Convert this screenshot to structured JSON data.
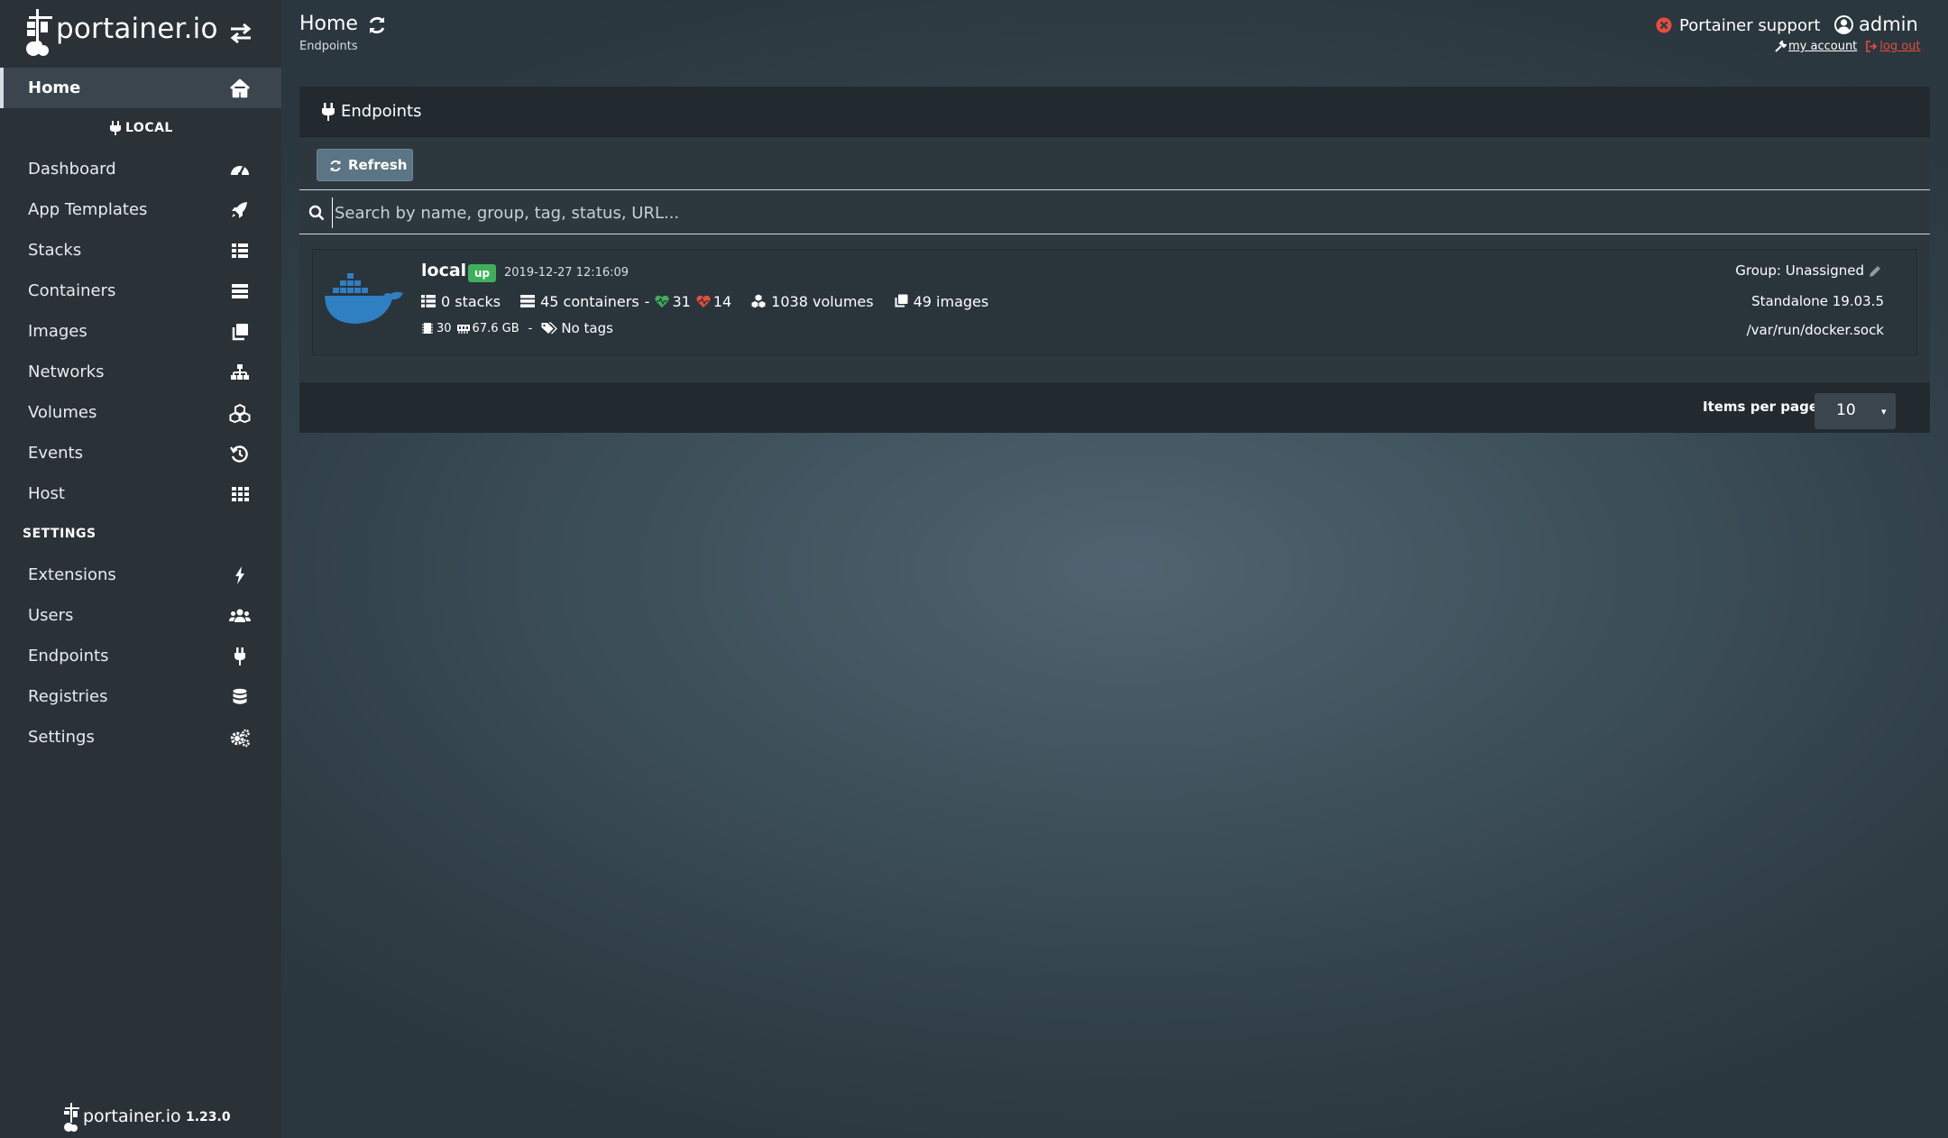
{
  "brand": {
    "name": "portainer.io",
    "logo_icon": "portainer-logo-icon",
    "toggle_icon": "sidebar-toggle-arrows-icon"
  },
  "sidebar": {
    "items": [
      {
        "label": "Home",
        "icon": "home-icon",
        "active": true
      },
      {
        "label": "Dashboard",
        "icon": "tachometer-icon"
      },
      {
        "label": "App Templates",
        "icon": "rocket-icon"
      },
      {
        "label": "Stacks",
        "icon": "th-list-icon"
      },
      {
        "label": "Containers",
        "icon": "server-icon"
      },
      {
        "label": "Images",
        "icon": "clone-icon"
      },
      {
        "label": "Networks",
        "icon": "sitemap-icon"
      },
      {
        "label": "Volumes",
        "icon": "cubes-icon"
      },
      {
        "label": "Events",
        "icon": "history-icon"
      },
      {
        "label": "Host",
        "icon": "th-icon"
      },
      {
        "label": "Extensions",
        "icon": "bolt-icon"
      },
      {
        "label": "Users",
        "icon": "users-icon"
      },
      {
        "label": "Endpoints",
        "icon": "plug-icon"
      },
      {
        "label": "Registries",
        "icon": "database-icon"
      },
      {
        "label": "Settings",
        "icon": "cogs-icon"
      }
    ],
    "endpoint_section": "LOCAL",
    "settings_section": "SETTINGS",
    "footer": {
      "name": "portainer.io",
      "version": "1.23.0"
    }
  },
  "header": {
    "title": "Home",
    "breadcrumb": "Endpoints",
    "support_label": "Portainer support",
    "user_label": "admin",
    "my_account_label": "my account",
    "log_out_label": "log out"
  },
  "endpoints_widget": {
    "title": "Endpoints",
    "refresh_label": "Refresh",
    "search_placeholder": "Search by name, group, tag, status, URL...",
    "endpoint": {
      "name": "local",
      "status": "up",
      "date": "2019-12-27 12:16:09",
      "stacks": "0 stacks",
      "containers": "45 containers",
      "containers_sep": "-",
      "healthy": "31",
      "unhealthy": "14",
      "volumes": "1038 volumes",
      "images": "49 images",
      "cpu": "30",
      "memory": "67.6 GB",
      "tags_sep": "-",
      "tags": "No tags",
      "group": "Group: Unassigned",
      "type": "Standalone 19.03.5",
      "url": "/var/run/docker.sock"
    },
    "items_per_page_label": "Items per page",
    "items_per_page": "10"
  },
  "colors": {
    "sidebar_bg": "#2a3137",
    "status_up": "#3fb05a",
    "healthy": "#3fb05a",
    "unhealthy": "#e84c3d",
    "docker_blue": "#2f7fc3",
    "support_red": "#e84c3d"
  }
}
